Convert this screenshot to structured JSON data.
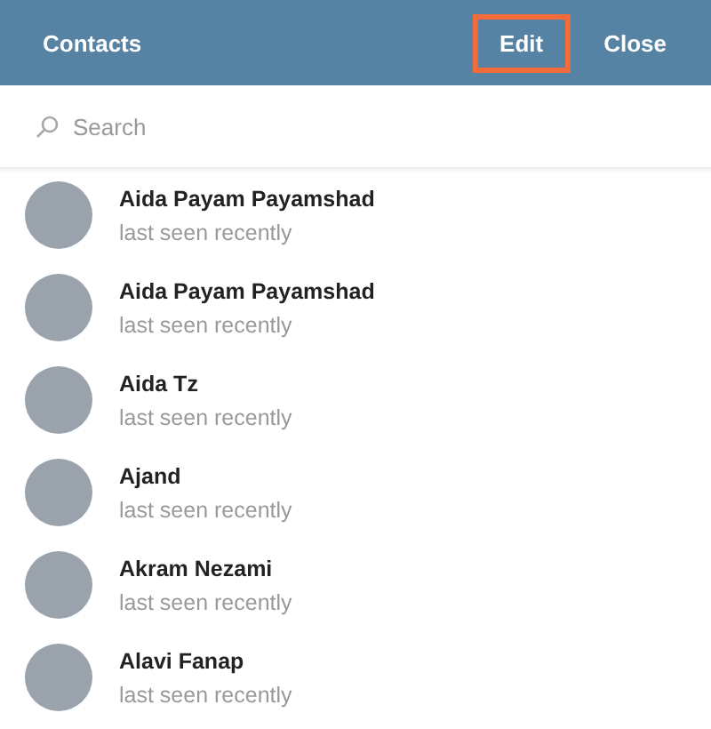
{
  "header": {
    "title": "Contacts",
    "actions": [
      {
        "label": "Edit",
        "highlighted": true
      },
      {
        "label": "Close",
        "highlighted": false
      }
    ]
  },
  "search": {
    "placeholder": "Search"
  },
  "contacts": [
    {
      "name": "Aida Payam Payamshad",
      "status": "last seen recently"
    },
    {
      "name": "Aida Payam Payamshad",
      "status": "last seen recently"
    },
    {
      "name": "Aida Tz",
      "status": "last seen recently"
    },
    {
      "name": "Ajand",
      "status": "last seen recently"
    },
    {
      "name": "Akram Nezami",
      "status": "last seen recently"
    },
    {
      "name": "Alavi Fanap",
      "status": "last seen recently"
    }
  ]
}
